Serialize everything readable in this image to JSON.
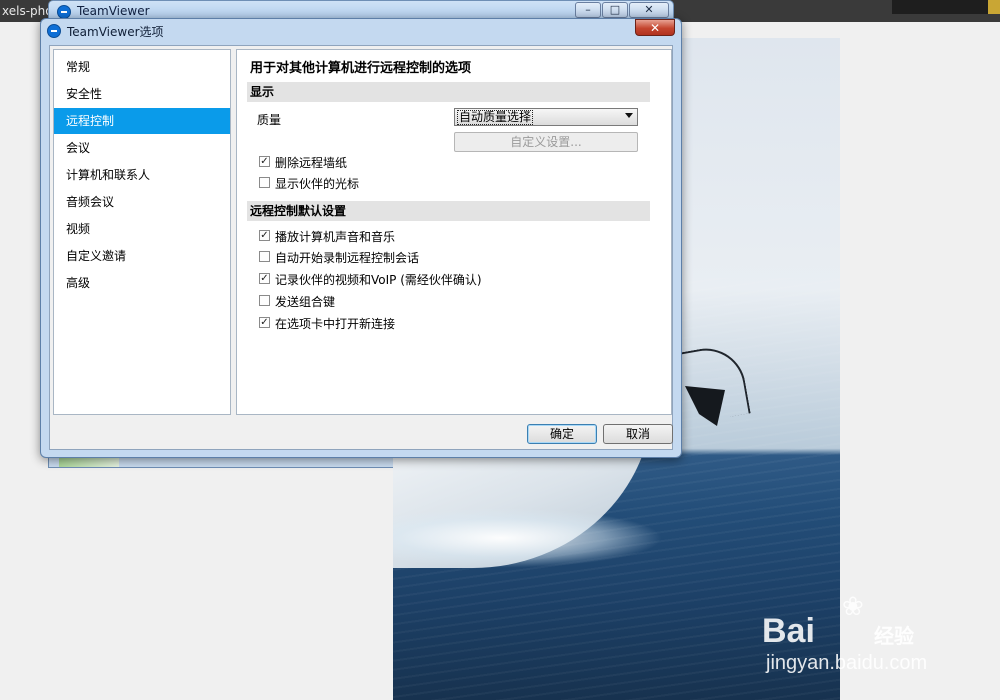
{
  "background": {
    "tab_text": "xels-photo",
    "main_window_title": "TeamViewer",
    "main_window_controls": {
      "minimize": "–",
      "maximize": "□",
      "close": "✕"
    }
  },
  "watermark": {
    "logo": "Bai",
    "logo_cn": "经验",
    "url": "jingyan.baidu.com",
    "paw": "❀"
  },
  "dialog": {
    "title": "TeamViewer选项",
    "close_glyph": "✕",
    "nav": {
      "items": [
        {
          "label": "常规",
          "selected": false
        },
        {
          "label": "安全性",
          "selected": false
        },
        {
          "label": "远程控制",
          "selected": true
        },
        {
          "label": "会议",
          "selected": false
        },
        {
          "label": "计算机和联系人",
          "selected": false
        },
        {
          "label": "音频会议",
          "selected": false
        },
        {
          "label": "视频",
          "selected": false
        },
        {
          "label": "自定义邀请",
          "selected": false
        },
        {
          "label": "高级",
          "selected": false
        }
      ]
    },
    "panel": {
      "title": "用于对其他计算机进行远程控制的选项",
      "display": {
        "header": "显示",
        "quality_label": "质量",
        "quality_value": "自动质量选择",
        "custom_settings": "自定义设置...",
        "options": [
          {
            "label": "删除远程墙纸",
            "checked": true
          },
          {
            "label": "显示伙伴的光标",
            "checked": false
          }
        ]
      },
      "defaults": {
        "header": "远程控制默认设置",
        "options": [
          {
            "label": "播放计算机声音和音乐",
            "checked": true
          },
          {
            "label": "自动开始录制远程控制会话",
            "checked": false
          },
          {
            "label": "记录伙伴的视频和VoIP (需经伙伴确认)",
            "checked": true
          },
          {
            "label": "发送组合键",
            "checked": false
          },
          {
            "label": "在选项卡中打开新连接",
            "checked": true
          }
        ]
      }
    },
    "buttons": {
      "ok": "确定",
      "cancel": "取消"
    },
    "check_glyph": "✓"
  },
  "colors": {
    "selection": "#0a9bea",
    "title_gradient_top": "#cfe2f6",
    "close_red": "#c4452f"
  }
}
